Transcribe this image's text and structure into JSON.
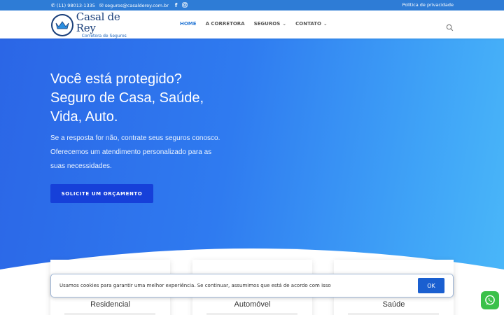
{
  "topbar": {
    "phone": "(11) 98013-1335",
    "email": "seguros@casalderey.com.br",
    "social": [
      "facebook-icon",
      "instagram-icon"
    ],
    "privacy_link": "Política de privacidade"
  },
  "header": {
    "logo_name": "Casal de Rey",
    "logo_sub": "Corretora de Seguros",
    "nav": [
      {
        "label": "HOME",
        "active": true,
        "has_dropdown": false
      },
      {
        "label": "A CORRETORA",
        "active": false,
        "has_dropdown": false
      },
      {
        "label": "SEGUROS",
        "active": false,
        "has_dropdown": true
      },
      {
        "label": "CONTATO",
        "active": false,
        "has_dropdown": true
      }
    ]
  },
  "hero": {
    "title_lines": [
      "Você está protegido?",
      "Seguro de Casa, Saúde,",
      "Vida, Auto."
    ],
    "text_lines": [
      "Se a resposta for não, contrate seus seguros conosco.",
      "Oferecemos um atendimento personalizado para as",
      "suas necessidades."
    ],
    "cta_label": "SOLICITE UM ORÇAMENTO"
  },
  "cards": [
    {
      "title": "Residencial"
    },
    {
      "title": "Automóvel"
    },
    {
      "title": "Saúde"
    }
  ],
  "cookie": {
    "message": "Usamos cookies para garantir uma melhor experiência. Se continuar, assumimos que está de acordo com isso",
    "ok_label": "OK"
  },
  "colors": {
    "topbar": "#2e7cd6",
    "nav_active": "#2e7cd6",
    "cta": "#1640d9",
    "whatsapp": "#3bc14a"
  }
}
